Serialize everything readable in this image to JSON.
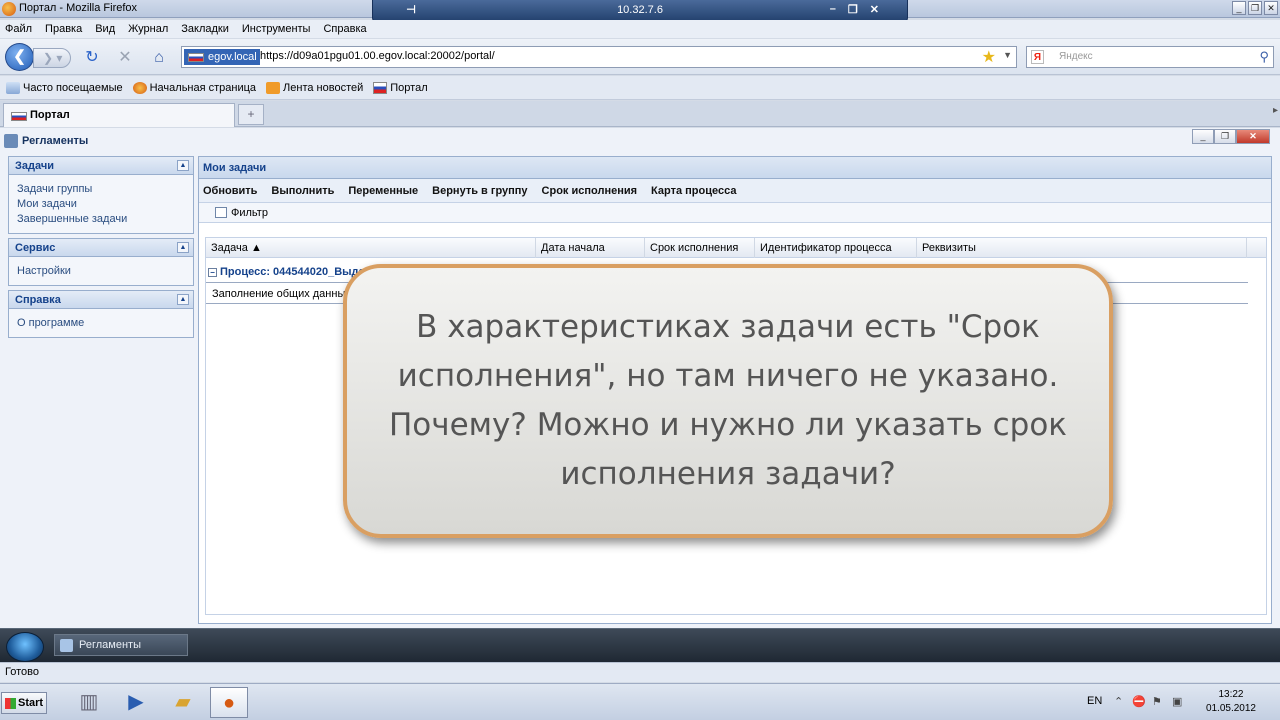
{
  "browser": {
    "title": "Портал - Mozilla Firefox",
    "remote_ip": "10.32.7.6",
    "menu": [
      "Файл",
      "Правка",
      "Вид",
      "Журнал",
      "Закладки",
      "Инструменты",
      "Справка"
    ],
    "site_label": "egov.local",
    "url": "https://d09a01pgu01.00.egov.local:20002/portal/",
    "search_placeholder": "Яндекс",
    "bookmarks": [
      "Часто посещаемые",
      "Начальная страница",
      "Лента новостей",
      "Портал"
    ],
    "tab_label": "Портал",
    "new_tab_label": "+",
    "status_text": "Готово"
  },
  "app": {
    "title": "Регламенты",
    "sidebar": {
      "tasks": {
        "header": "Задачи",
        "items": [
          "Задачи группы",
          "Мои задачи",
          "Завершенные задачи"
        ]
      },
      "service": {
        "header": "Сервис",
        "items": [
          "Настройки"
        ]
      },
      "help": {
        "header": "Справка",
        "items": [
          "О программе"
        ]
      }
    },
    "main": {
      "header": "Мои задачи",
      "toolbar": [
        "Обновить",
        "Выполнить",
        "Переменные",
        "Вернуть в группу",
        "Срок исполнения",
        "Карта процесса"
      ],
      "filter_label": "Фильтр",
      "columns": [
        "Задача ▲",
        "Дата начала",
        "Срок исполнения",
        "Идентификатор процесса",
        "Реквизиты"
      ],
      "group_label": "Процесс: 044544020_Выда",
      "task_row": "Заполнение общих данных"
    }
  },
  "app_taskbar": {
    "item": "Регламенты"
  },
  "win_taskbar": {
    "start": "Start",
    "lang": "EN",
    "time": "13:22",
    "date": "01.05.2012"
  },
  "overlay": {
    "text": "В характеристиках задачи есть \"Срок исполнения\", но там ничего не указано. Почему? Можно и нужно ли указать срок исполнения задачи?"
  },
  "colors": {
    "accent": "#15428b",
    "bubble_border": "#d99f62",
    "url_highlight": "#3465b5"
  }
}
